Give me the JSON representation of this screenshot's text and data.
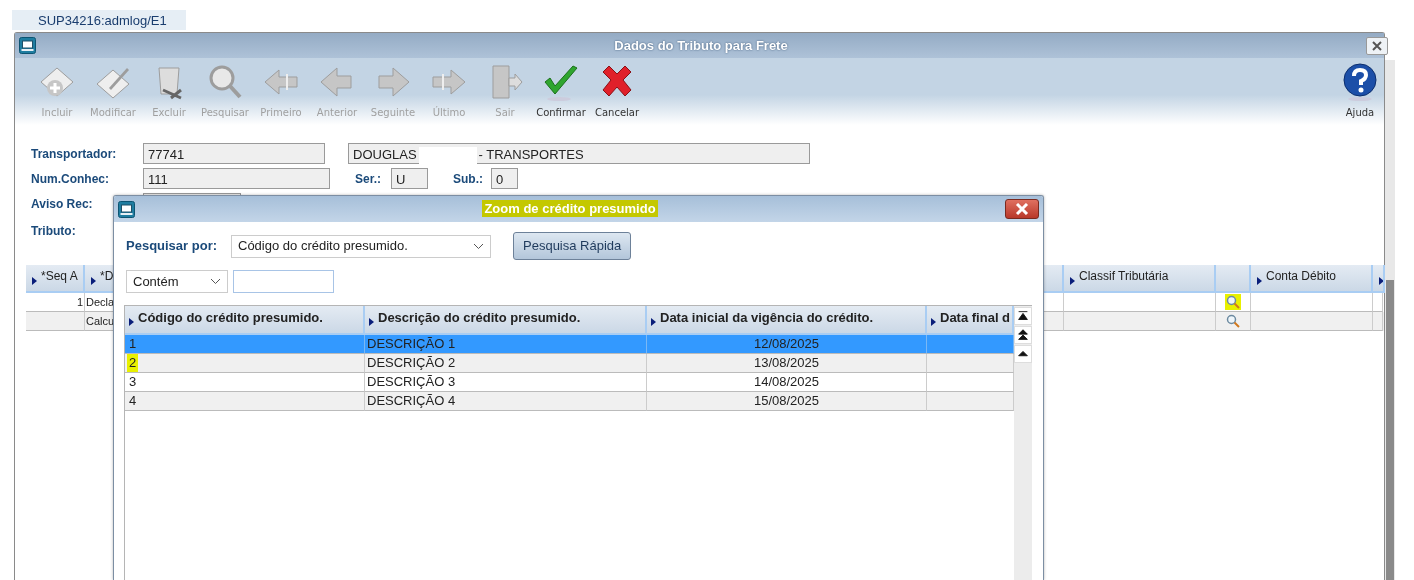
{
  "tab": {
    "label": "SUP34216:admlog/E1"
  },
  "window": {
    "title": "Dados do Tributo para Frete"
  },
  "toolbar": [
    {
      "kind": "add",
      "label": "Incluir",
      "enabled": false
    },
    {
      "kind": "edit",
      "label": "Modificar",
      "enabled": false
    },
    {
      "kind": "delete",
      "label": "Excluir",
      "enabled": false
    },
    {
      "kind": "search",
      "label": "Pesquisar",
      "enabled": false
    },
    {
      "kind": "first",
      "label": "Primeiro",
      "enabled": false
    },
    {
      "kind": "prev",
      "label": "Anterior",
      "enabled": false
    },
    {
      "kind": "next",
      "label": "Seguinte",
      "enabled": false
    },
    {
      "kind": "last",
      "label": "Último",
      "enabled": false
    },
    {
      "kind": "exit",
      "label": "Sair",
      "enabled": false
    },
    {
      "kind": "confirm",
      "label": "Confirmar",
      "enabled": true
    },
    {
      "kind": "cancel",
      "label": "Cancelar",
      "enabled": true
    }
  ],
  "help_button": {
    "label": "Ajuda"
  },
  "form": {
    "transportador": {
      "label": "Transportador:",
      "code": "77741",
      "name": [
        "DOUGLAS",
        "- TRANSPORTES"
      ]
    },
    "num_conhec": {
      "label": "Num.Conhec:",
      "value": "111"
    },
    "serie": {
      "label": "Ser.:",
      "value": "U"
    },
    "sub": {
      "label": "Sub.:",
      "value": "0"
    },
    "aviso_rec": {
      "label": "Aviso Rec:"
    },
    "tributo": {
      "label": "Tributo:"
    }
  },
  "items_grid": {
    "columns": [
      {
        "kind": "text",
        "label": "*Seq A"
      },
      {
        "kind": "text",
        "label": "*D"
      },
      {
        "kind": "text",
        "label": "Classif Tributária"
      },
      {
        "kind": "lookup"
      },
      {
        "kind": "text",
        "label": "Conta Débito"
      },
      {
        "kind": "stub"
      }
    ],
    "rows": [
      {
        "seq": "1",
        "desc": "Decla",
        "lookup_highlighted": true
      },
      {
        "desc": "Calcu",
        "lookup_highlighted": false
      }
    ]
  },
  "dialog": {
    "title": "Zoom de crédito presumido",
    "title_highlighted": true,
    "search_by": {
      "label": "Pesquisar por:",
      "value": "Código do crédito presumido."
    },
    "quick_search": {
      "label": "Pesquisa Rápida"
    },
    "match": {
      "value": "Contém"
    },
    "columns": [
      "Código do crédito presumido.",
      "Descrição do crédito presumido.",
      "Data inicial da vigência do crédito.",
      "Data final d"
    ],
    "rows": [
      {
        "code": "1",
        "description": "DESCRIÇÃO 1",
        "start": "12/08/2025",
        "selected": true,
        "code_highlighted": false
      },
      {
        "code": "2",
        "description": "DESCRIÇÃO 2",
        "start": "13/08/2025",
        "selected": false,
        "code_highlighted": true
      },
      {
        "code": "3",
        "description": "DESCRIÇÃO 3",
        "start": "14/08/2025",
        "selected": false,
        "code_highlighted": false
      },
      {
        "code": "4",
        "description": "DESCRIÇÃO 4",
        "start": "15/08/2025",
        "selected": false,
        "code_highlighted": false
      }
    ]
  }
}
